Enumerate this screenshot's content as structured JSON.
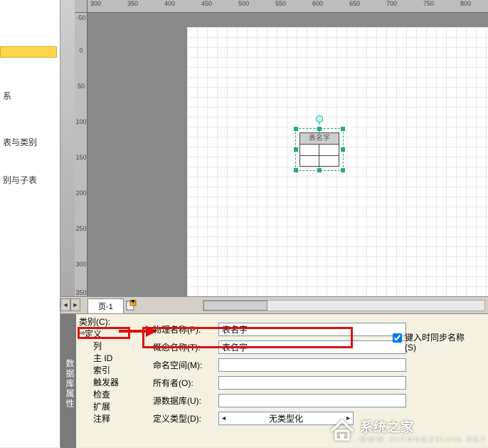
{
  "ruler_top": [
    "300",
    "350",
    "400",
    "450",
    "500",
    "550",
    "600",
    "650",
    "700",
    "750",
    "800"
  ],
  "ruler_left": [
    "-50",
    "0",
    "50",
    "100",
    "150",
    "200",
    "250",
    "300",
    "350"
  ],
  "outline": {
    "item1": "系",
    "item2": "表与类别",
    "item3": "别与子表"
  },
  "canvas": {
    "shape_title": "表名字"
  },
  "tabs": {
    "page1": "页-1"
  },
  "side_label": "数据库属性",
  "tree": {
    "category": "类别(C):",
    "definition": "定义",
    "column": "列",
    "primary_id": "主 ID",
    "index": "索引",
    "trigger": "触发器",
    "check": "检查",
    "extend": "扩展",
    "note": "注释"
  },
  "form": {
    "physical_label": "物理名称(P):",
    "physical_value": "表名字",
    "concept_label": "概念名称(T):",
    "concept_value": "表名字",
    "namespace_label": "命名空间(M):",
    "namespace_value": "",
    "owner_label": "所有者(O):",
    "owner_value": "",
    "source_label": "源数据库(U):",
    "source_value": "",
    "type_label": "定义类型(D):",
    "type_value": "无类型化",
    "sync_label": "键入时同步名称(S)"
  },
  "watermark": {
    "title": "系统之家",
    "url": "W W W . X I T O N G Z H I J I A . N E T"
  }
}
